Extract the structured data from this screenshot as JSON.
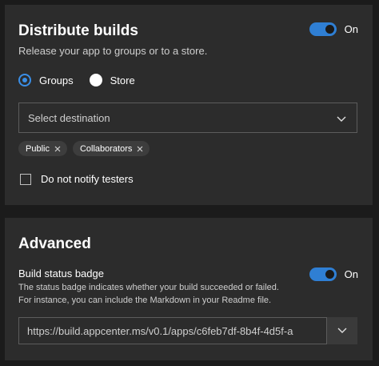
{
  "distribute": {
    "title": "Distribute builds",
    "subtitle": "Release your app to groups or to a store.",
    "toggle": {
      "state_label": "On",
      "on": true
    },
    "radios": [
      {
        "label": "Groups",
        "selected": true
      },
      {
        "label": "Store",
        "selected": false
      }
    ],
    "destination": {
      "placeholder": "Select destination"
    },
    "chips": [
      "Public",
      "Collaborators"
    ],
    "notify_checkbox": {
      "label": "Do not notify testers",
      "checked": false
    }
  },
  "advanced": {
    "title": "Advanced",
    "badge": {
      "label": "Build status badge",
      "description": "The status badge indicates whether your build succeeded or failed. For instance, you can include the Markdown in your Readme file.",
      "toggle": {
        "state_label": "On",
        "on": true
      },
      "url": "https://build.appcenter.ms/v0.1/apps/c6feb7df-8b4f-4d5f-a"
    }
  },
  "colors": {
    "accent": "#2f7fd4",
    "card_bg": "#2c2c2c",
    "page_bg": "#1b1b1b"
  },
  "icons": {
    "dropdown": "chevron-down-icon",
    "chip_remove": "close-icon"
  }
}
